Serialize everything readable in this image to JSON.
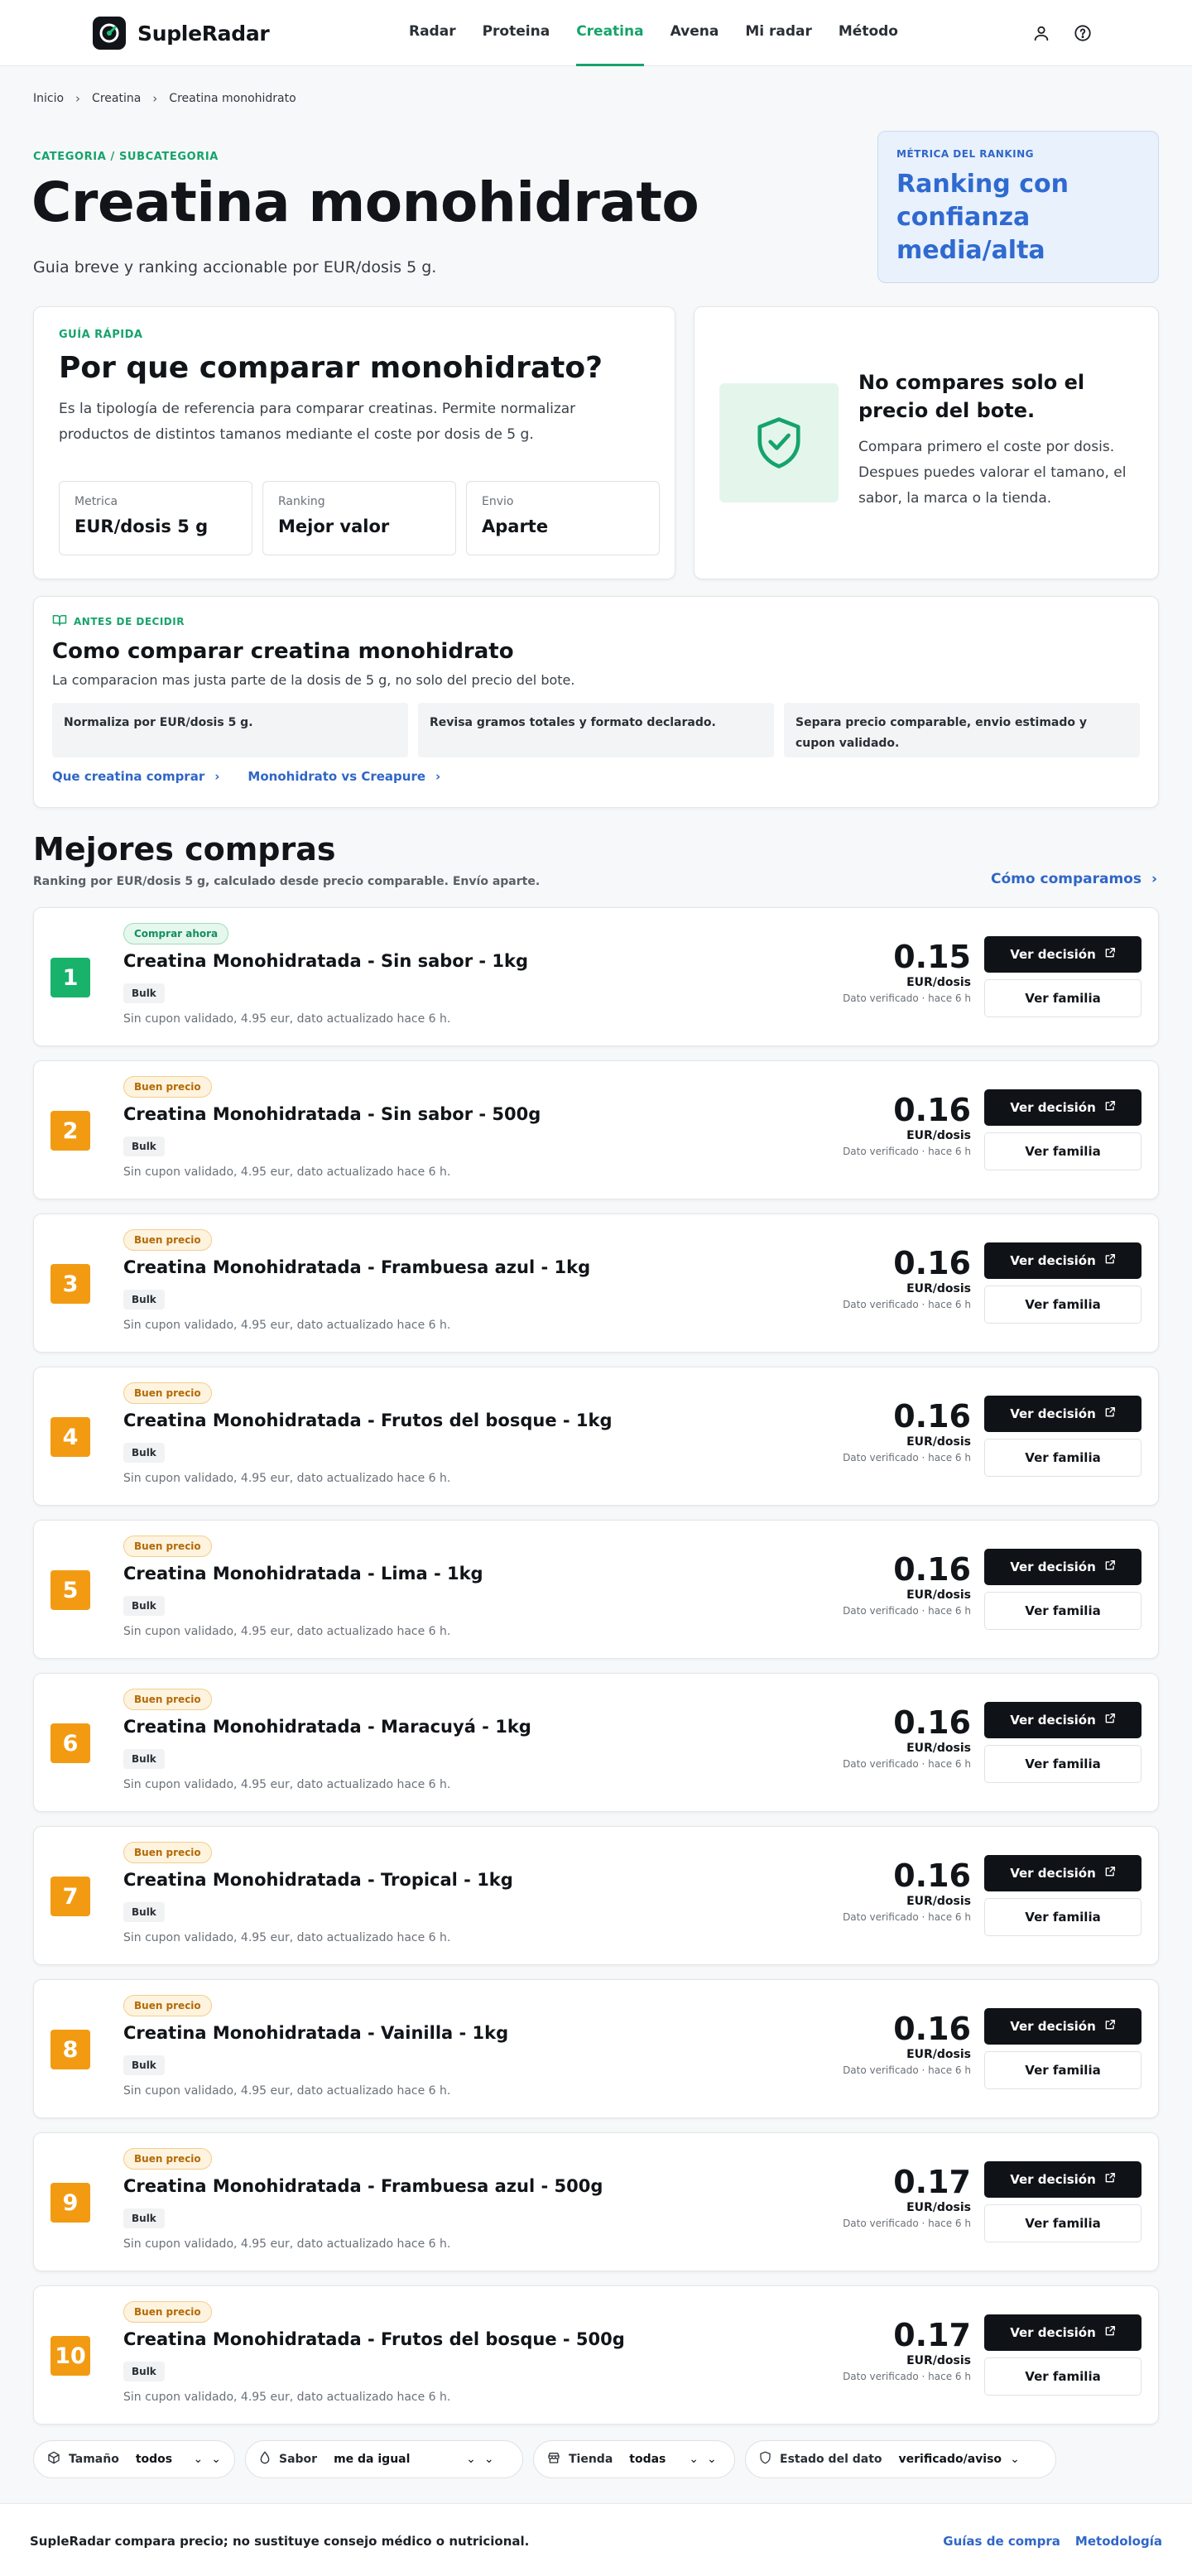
{
  "header": {
    "brand": "SupleRadar",
    "nav": [
      "Radar",
      "Proteina",
      "Creatina",
      "Avena",
      "Mi radar",
      "Método"
    ],
    "active_nav": 2
  },
  "breadcrumb": [
    "Inicio",
    "Creatina",
    "Creatina monohidrato"
  ],
  "hero": {
    "kicker": "CATEGORIA / SUBCATEGORIA",
    "title": "Creatina monohidrato",
    "subtitle": "Guia breve y ranking accionable por EUR/dosis 5 g."
  },
  "metric": {
    "kicker": "MÉTRICA DEL RANKING",
    "value": "Ranking con confianza media/alta"
  },
  "guide": {
    "kicker": "GUÍA RÁPIDA",
    "title": "Por que comparar monohidrato?",
    "text": "Es la tipología de referencia para comparar creatinas. Permite normalizar productos de distintos tamanos mediante el coste por dosis de 5 g.",
    "stats": [
      {
        "label": "Metrica",
        "value": "EUR/dosis 5 g"
      },
      {
        "label": "Ranking",
        "value": "Mejor valor"
      },
      {
        "label": "Envio",
        "value": "Aparte"
      }
    ]
  },
  "warning": {
    "title": "No compares solo el precio del bote.",
    "text": "Compara primero el coste por dosis. Despues puedes valorar el tamano, el sabor, la marca o la tienda."
  },
  "decide": {
    "kicker": "ANTES DE DECIDIR",
    "title": "Como comparar creatina monohidrato",
    "text": "La comparacion mas justa parte de la dosis de 5 g, no solo del precio del bote.",
    "tips": [
      "Normaliza por EUR/dosis 5 g.",
      "Revisa gramos totales y formato declarado.",
      "Separa precio comparable, envio estimado y cupon validado."
    ],
    "links": [
      "Que creatina comprar",
      "Monohidrato vs Creapure"
    ]
  },
  "ranking": {
    "title": "Mejores compras",
    "subtitle": "Ranking por EUR/dosis 5 g, calculado desde precio comparable. Envío aparte.",
    "how_link": "Cómo comparamos",
    "decision_label": "Ver decisión",
    "family_label": "Ver familia",
    "unit": "EUR/dosis",
    "verified": "Dato verificado · hace 6 h",
    "note": "Sin cupon validado, 4.95 eur, dato actualizado hace 6 h.",
    "colors": {
      "best": "#18b26b",
      "good": "#f29b12"
    },
    "items": [
      {
        "rank": "1",
        "tag": "Comprar ahora",
        "tag_type": "best",
        "name": "Creatina Monohidratada - Sin sabor - 1kg",
        "size": "Bulk",
        "price": "0.15"
      },
      {
        "rank": "2",
        "tag": "Buen precio",
        "tag_type": "good",
        "name": "Creatina Monohidratada - Sin sabor - 500g",
        "size": "Bulk",
        "price": "0.16"
      },
      {
        "rank": "3",
        "tag": "Buen precio",
        "tag_type": "good",
        "name": "Creatina Monohidratada - Frambuesa azul - 1kg",
        "size": "Bulk",
        "price": "0.16"
      },
      {
        "rank": "4",
        "tag": "Buen precio",
        "tag_type": "good",
        "name": "Creatina Monohidratada - Frutos del bosque - 1kg",
        "size": "Bulk",
        "price": "0.16"
      },
      {
        "rank": "5",
        "tag": "Buen precio",
        "tag_type": "good",
        "name": "Creatina Monohidratada - Lima - 1kg",
        "size": "Bulk",
        "price": "0.16"
      },
      {
        "rank": "6",
        "tag": "Buen precio",
        "tag_type": "good",
        "name": "Creatina Monohidratada - Maracuyá - 1kg",
        "size": "Bulk",
        "price": "0.16"
      },
      {
        "rank": "7",
        "tag": "Buen precio",
        "tag_type": "good",
        "name": "Creatina Monohidratada - Tropical - 1kg",
        "size": "Bulk",
        "price": "0.16"
      },
      {
        "rank": "8",
        "tag": "Buen precio",
        "tag_type": "good",
        "name": "Creatina Monohidratada - Vainilla - 1kg",
        "size": "Bulk",
        "price": "0.16"
      },
      {
        "rank": "9",
        "tag": "Buen precio",
        "tag_type": "good",
        "name": "Creatina Monohidratada - Frambuesa azul - 500g",
        "size": "Bulk",
        "price": "0.17"
      },
      {
        "rank": "10",
        "tag": "Buen precio",
        "tag_type": "good",
        "name": "Creatina Monohidratada - Frutos del bosque - 500g",
        "size": "Bulk",
        "price": "0.17"
      }
    ]
  },
  "filters": [
    {
      "icon": "box-icon",
      "label": "Tamaño",
      "value": "todos"
    },
    {
      "icon": "drop-icon",
      "label": "Sabor",
      "value": "me da igual"
    },
    {
      "icon": "store-icon",
      "label": "Tienda",
      "value": "todas"
    },
    {
      "icon": "shield-icon",
      "label": "Estado del dato",
      "value": "verificado/aviso"
    }
  ],
  "footer": {
    "note": "SupleRadar compara precio; no sustituye consejo médico o nutricional.",
    "links": [
      "Guías de compra",
      "Metodología"
    ]
  }
}
